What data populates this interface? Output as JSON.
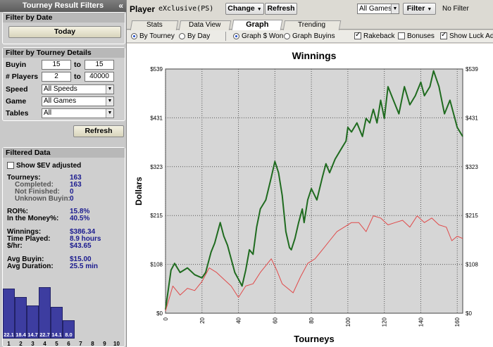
{
  "left_panel": {
    "title": "Tourney Result Filters",
    "collapse_glyph": "«",
    "filter_by_date": {
      "title": "Filter by Date",
      "today_label": "Today"
    },
    "filter_by_details": {
      "title": "Filter by Tourney Details",
      "buyin_label": "Buyin",
      "buyin_min": "15",
      "buyin_to": "to",
      "buyin_max": "15",
      "players_label": "# Players",
      "players_min": "2",
      "players_to": "to",
      "players_max": "40000",
      "speed_label": "Speed",
      "speed_value": "All Speeds",
      "game_label": "Game",
      "game_value": "All Games",
      "tables_label": "Tables",
      "tables_value": "All"
    },
    "refresh_label": "Refresh",
    "filtered_data": {
      "title": "Filtered Data",
      "show_ev_label": "Show $EV adjusted",
      "tourneys_label": "Tourneys:",
      "tourneys": "163",
      "completed_label": "Completed:",
      "completed": "163",
      "not_finished_label": "Not Finished:",
      "not_finished": "0",
      "unknown_buyin_label": "Unknown Buyin:",
      "unknown_buyin": "0",
      "roi_label": "ROI%:",
      "roi": "15.8%",
      "itm_label": "In the Money%:",
      "itm": "40.5%",
      "winnings_label": "Winnings:",
      "winnings": "$386.34",
      "time_played_label": "Time Played:",
      "time_played": "8.9 hours",
      "per_hour_label": "$/hr:",
      "per_hour": "$43.65",
      "avg_buyin_label": "Avg Buyin:",
      "avg_buyin": "$15.00",
      "avg_duration_label": "Avg Duration:",
      "avg_duration": "25.5 min"
    },
    "finish_histogram": {
      "positions": [
        "1",
        "2",
        "3",
        "4",
        "5",
        "6",
        "7",
        "8",
        "9",
        "10"
      ],
      "percents": [
        22.1,
        18.4,
        14.7,
        22.7,
        14.1,
        8.0,
        0,
        0,
        0,
        0
      ],
      "bar_labels": [
        "22.1",
        "18.4",
        "14.7",
        "22.7",
        "14.1",
        "8.0",
        "",
        "",
        "",
        ""
      ]
    }
  },
  "topbar": {
    "player_label": "Player",
    "player_name": "eXclusive(PS)",
    "change_label": "Change",
    "refresh_label": "Refresh",
    "games_value": "All Games",
    "filter_label": "Filter",
    "no_filter_text": "No Filter"
  },
  "tabs": [
    {
      "label": "Stats",
      "active": false
    },
    {
      "label": "Data View",
      "active": false
    },
    {
      "label": "Graph",
      "active": true
    },
    {
      "label": "Trending",
      "active": false
    }
  ],
  "options": {
    "by_tourney": "By Tourney",
    "by_day": "By Day",
    "graph_won": "Graph $ Won",
    "graph_buyins": "Graph Buyins",
    "rakeback": "Rakeback",
    "bonuses": "Bonuses",
    "show_luck": "Show Luck Adju",
    "selected_period": "By Tourney",
    "selected_graph": "Graph $ Won",
    "rakeback_checked": true,
    "bonuses_checked": false,
    "show_luck_checked": true
  },
  "chart_data": {
    "type": "line",
    "title": "Winnings",
    "xlabel": "Tourneys",
    "ylabel": "Dollars",
    "xlim": [
      0,
      163
    ],
    "ylim": [
      0,
      539
    ],
    "yticks": [
      "$0",
      "$108",
      "$215",
      "$323",
      "$431",
      "$539"
    ],
    "xticks": [
      "0",
      "20",
      "40",
      "60",
      "80",
      "100",
      "120",
      "140",
      "160"
    ],
    "grid": true,
    "colors": {
      "winnings": "#1f6b1f",
      "luck": "#e04a4a",
      "plot_bg": "#d6d6d6"
    },
    "series": [
      {
        "name": "",
        "color": "#1f6b1f",
        "points": [
          [
            0,
            8
          ],
          [
            3,
            95
          ],
          [
            5,
            110
          ],
          [
            8,
            90
          ],
          [
            12,
            100
          ],
          [
            16,
            85
          ],
          [
            20,
            78
          ],
          [
            22,
            90
          ],
          [
            25,
            135
          ],
          [
            27,
            155
          ],
          [
            30,
            200
          ],
          [
            32,
            170
          ],
          [
            34,
            150
          ],
          [
            36,
            120
          ],
          [
            38,
            90
          ],
          [
            40,
            75
          ],
          [
            42,
            60
          ],
          [
            44,
            95
          ],
          [
            46,
            140
          ],
          [
            48,
            130
          ],
          [
            50,
            190
          ],
          [
            52,
            230
          ],
          [
            55,
            250
          ],
          [
            58,
            300
          ],
          [
            60,
            335
          ],
          [
            62,
            310
          ],
          [
            64,
            260
          ],
          [
            66,
            180
          ],
          [
            68,
            145
          ],
          [
            69,
            140
          ],
          [
            71,
            165
          ],
          [
            73,
            200
          ],
          [
            75,
            230
          ],
          [
            76,
            200
          ],
          [
            78,
            250
          ],
          [
            80,
            275
          ],
          [
            83,
            250
          ],
          [
            86,
            300
          ],
          [
            88,
            330
          ],
          [
            90,
            310
          ],
          [
            93,
            340
          ],
          [
            96,
            360
          ],
          [
            99,
            380
          ],
          [
            100,
            410
          ],
          [
            102,
            400
          ],
          [
            105,
            420
          ],
          [
            108,
            390
          ],
          [
            110,
            430
          ],
          [
            112,
            420
          ],
          [
            114,
            450
          ],
          [
            116,
            420
          ],
          [
            118,
            470
          ],
          [
            120,
            430
          ],
          [
            122,
            500
          ],
          [
            125,
            470
          ],
          [
            128,
            440
          ],
          [
            131,
            500
          ],
          [
            134,
            460
          ],
          [
            137,
            480
          ],
          [
            140,
            510
          ],
          [
            142,
            480
          ],
          [
            145,
            500
          ],
          [
            147,
            535
          ],
          [
            150,
            500
          ],
          [
            153,
            440
          ],
          [
            156,
            470
          ],
          [
            160,
            410
          ],
          [
            163,
            390
          ]
        ]
      },
      {
        "name": "",
        "color": "#e04a4a",
        "points": [
          [
            0,
            5
          ],
          [
            4,
            60
          ],
          [
            8,
            40
          ],
          [
            12,
            55
          ],
          [
            16,
            50
          ],
          [
            20,
            70
          ],
          [
            24,
            100
          ],
          [
            28,
            90
          ],
          [
            32,
            75
          ],
          [
            36,
            60
          ],
          [
            40,
            35
          ],
          [
            44,
            60
          ],
          [
            48,
            65
          ],
          [
            52,
            90
          ],
          [
            56,
            110
          ],
          [
            58,
            120
          ],
          [
            61,
            95
          ],
          [
            64,
            65
          ],
          [
            67,
            55
          ],
          [
            70,
            45
          ],
          [
            74,
            80
          ],
          [
            78,
            110
          ],
          [
            82,
            120
          ],
          [
            86,
            140
          ],
          [
            90,
            160
          ],
          [
            94,
            180
          ],
          [
            98,
            190
          ],
          [
            102,
            200
          ],
          [
            106,
            200
          ],
          [
            110,
            180
          ],
          [
            114,
            215
          ],
          [
            118,
            210
          ],
          [
            122,
            195
          ],
          [
            126,
            200
          ],
          [
            130,
            205
          ],
          [
            134,
            190
          ],
          [
            138,
            215
          ],
          [
            142,
            200
          ],
          [
            146,
            210
          ],
          [
            150,
            195
          ],
          [
            154,
            190
          ],
          [
            157,
            160
          ],
          [
            160,
            170
          ],
          [
            163,
            165
          ]
        ]
      }
    ]
  }
}
